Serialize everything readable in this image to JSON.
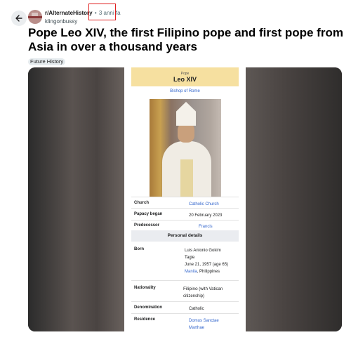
{
  "header": {
    "subreddit": "r/AlternateHistory",
    "separator": "•",
    "time_ago": "3 anni fa",
    "author": "klingonbussy"
  },
  "post": {
    "title": "Pope Leo XIV, the first Filipino pope and first pope from Asia in over a thousand years",
    "flair": "Future History"
  },
  "infobox": {
    "overline": "Pope",
    "name": "Leo XIV",
    "subtitle": "Bishop of Rome",
    "rows": [
      {
        "label": "Church",
        "value": "Catholic Church"
      },
      {
        "label": "Papacy began",
        "value": "20 February 2023"
      },
      {
        "label": "Predecessor",
        "value": "Francis"
      }
    ],
    "section": "Personal details",
    "born_label": "Born",
    "born_lines": [
      "Luis Antonio Gokim",
      "Tagle",
      "June 21, 1957 (age 65)"
    ],
    "born_place_link": "Manila",
    "born_place_rest": ", Philippines",
    "nationality_label": "Nationality",
    "nationality_value": "Filipino",
    "nationality_note": "(with Vatican",
    "nationality_note2": "citizenship)",
    "denomination_label": "Denomination",
    "denomination_value": "Catholic",
    "residence_label": "Residence",
    "residence_value1": "Domus Sanctae",
    "residence_value2": "Marthae"
  },
  "colors": {
    "infobox_header": "#f6e0a0",
    "link": "#3366cc",
    "highlight": "#e02020"
  }
}
